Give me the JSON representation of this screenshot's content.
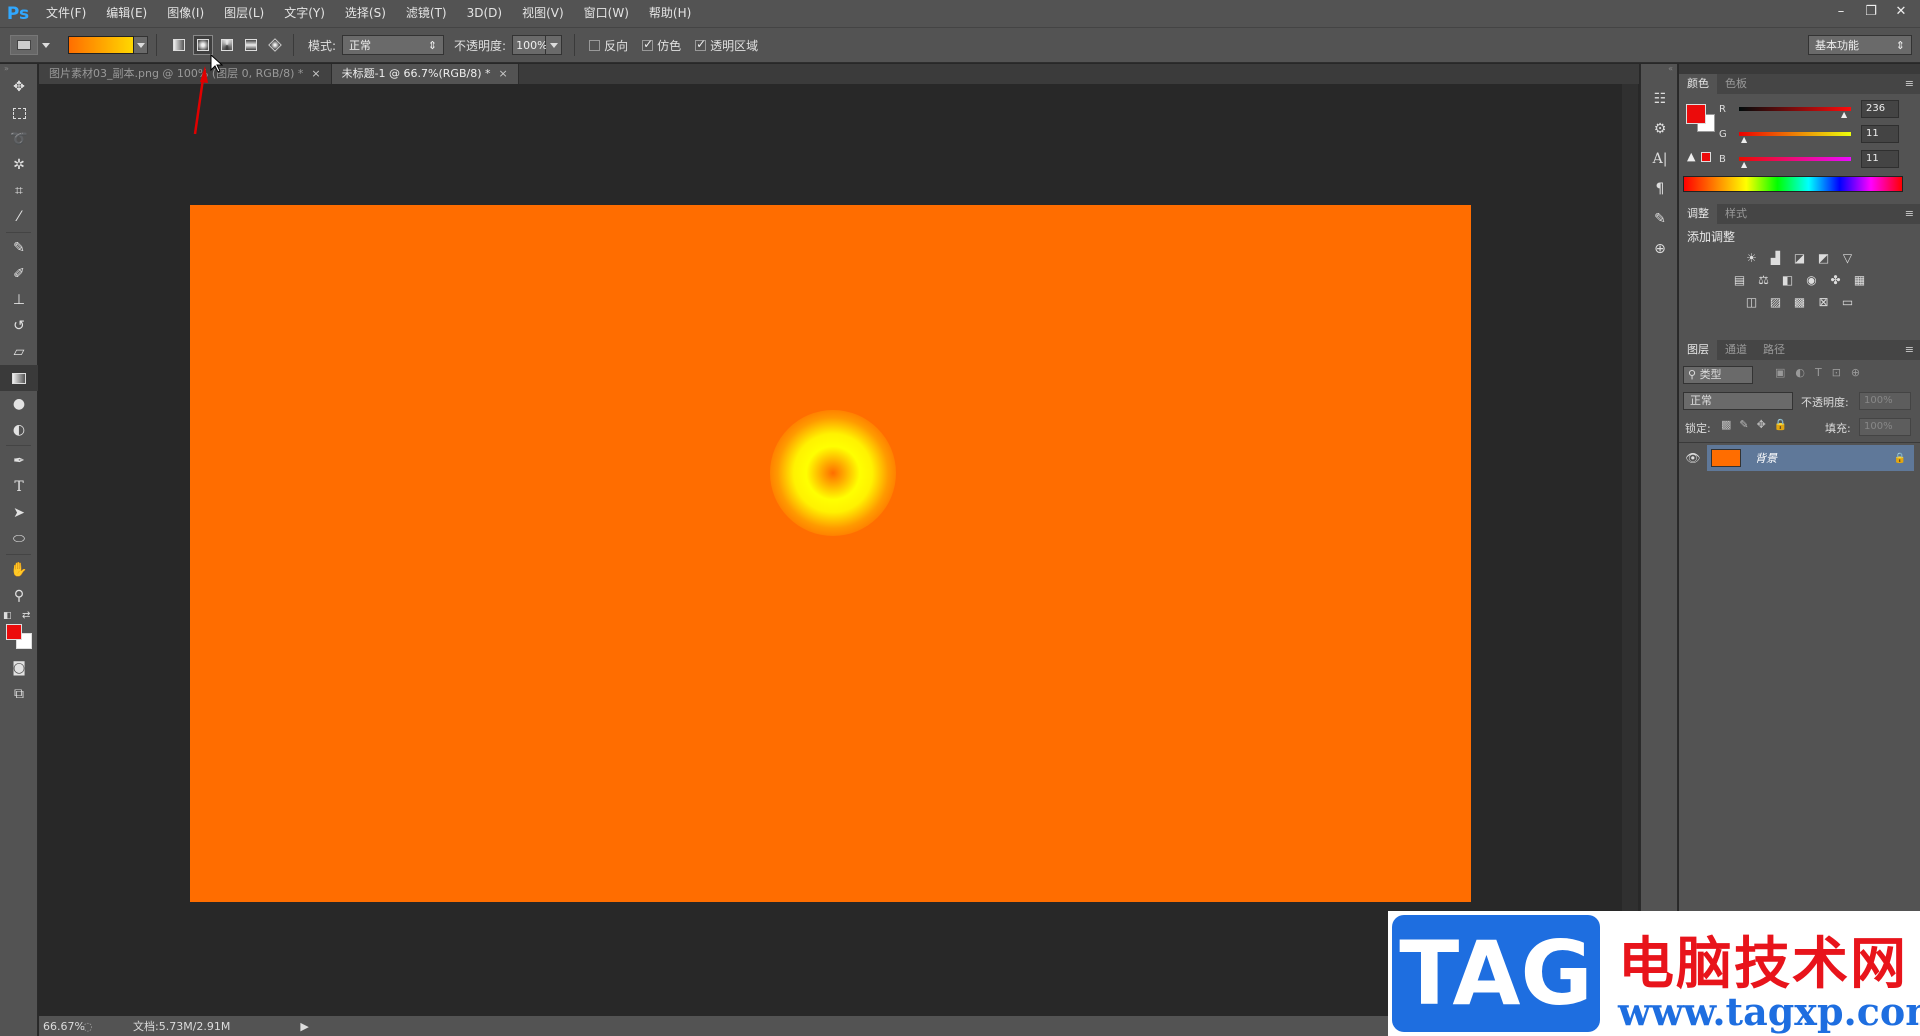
{
  "app": {
    "logo": "Ps"
  },
  "menu": [
    "文件(F)",
    "编辑(E)",
    "图像(I)",
    "图层(L)",
    "文字(Y)",
    "选择(S)",
    "滤镜(T)",
    "3D(D)",
    "视图(V)",
    "窗口(W)",
    "帮助(H)"
  ],
  "window_controls": [
    "–",
    "❐",
    "✕"
  ],
  "options": {
    "mode_label": "模式:",
    "mode_value": "正常",
    "opacity_label": "不透明度:",
    "opacity_value": "100%",
    "reverse_label": "反向",
    "dither_label": "仿色",
    "transparency_label": "透明区域",
    "workspace": "基本功能",
    "gradient_type_active": "radial"
  },
  "tabs": [
    {
      "label": "图片素材03_副本.png @ 100% (图层 0, RGB/8) *",
      "active": false
    },
    {
      "label": "未标题-1 @ 66.7%(RGB/8) *",
      "active": true
    }
  ],
  "status": {
    "zoom": "66.67%",
    "doc": "文档:5.73M/2.91M"
  },
  "colors": {
    "foreground": "#ec0b0b",
    "background": "#ffffff",
    "canvas": "#ff6d00"
  },
  "color_panel": {
    "tabs": [
      "颜色",
      "色板"
    ],
    "channels": [
      {
        "label": "R",
        "value": "236",
        "level": 0.925
      },
      {
        "label": "G",
        "value": "11",
        "level": 0.043
      },
      {
        "label": "B",
        "value": "11",
        "level": 0.043
      }
    ]
  },
  "adjust_panel": {
    "tabs": [
      "调整",
      "样式"
    ],
    "title": "添加调整"
  },
  "layers_panel": {
    "tabs": [
      "图层",
      "通道",
      "路径"
    ],
    "filter_kind": "类型",
    "blend_mode": "正常",
    "opacity_label": "不透明度:",
    "opacity_value": "100%",
    "lock_label": "锁定:",
    "fill_label": "填充:",
    "fill_value": "100%",
    "layers": [
      {
        "name": "背景",
        "visible": true,
        "locked": true
      }
    ]
  },
  "watermark": {
    "badge": "TAG",
    "site_name": "电脑技术网",
    "url": "www.tagxp.com"
  }
}
